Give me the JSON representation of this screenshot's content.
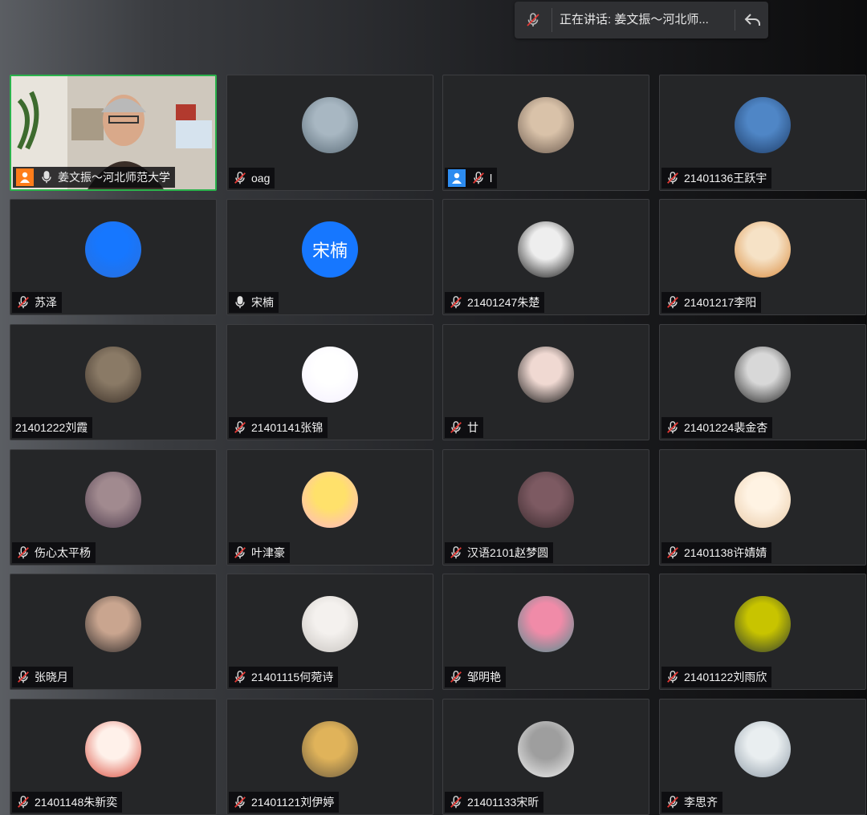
{
  "speaking_bar": {
    "text": "正在讲话: 姜文振～河北师...",
    "mic_state": "muted"
  },
  "colors": {
    "active_border": "#2bb24c",
    "host_badge": "#ff7d1a",
    "user_badge": "#2d8cf0",
    "text_avatar": "#1677ff"
  },
  "participants": [
    {
      "name": "姜文振～河北师范大学",
      "mic": "on",
      "badge": "host",
      "video": true,
      "active": true
    },
    {
      "name": "oag",
      "mic": "muted"
    },
    {
      "name": "l",
      "mic": "muted",
      "badge": "user"
    },
    {
      "name": "21401136王跃宇",
      "mic": "muted"
    },
    {
      "name": "苏泽",
      "mic": "muted"
    },
    {
      "name": "宋楠",
      "mic": "on",
      "avatar_text": "宋楠"
    },
    {
      "name": "21401247朱楚",
      "mic": "muted"
    },
    {
      "name": "21401217李阳",
      "mic": "muted"
    },
    {
      "name": "21401222刘霞",
      "mic": "none"
    },
    {
      "name": "21401141张锦",
      "mic": "muted"
    },
    {
      "name": "廿",
      "mic": "muted"
    },
    {
      "name": "21401224裴金杏",
      "mic": "muted"
    },
    {
      "name": "伤心太平杨",
      "mic": "muted"
    },
    {
      "name": "叶津豪",
      "mic": "muted"
    },
    {
      "name": "汉语2101赵梦圆",
      "mic": "muted"
    },
    {
      "name": "21401138许婧婧",
      "mic": "muted"
    },
    {
      "name": "张晓月",
      "mic": "muted"
    },
    {
      "name": "21401115何菀诗",
      "mic": "muted"
    },
    {
      "name": "邹明艳",
      "mic": "muted"
    },
    {
      "name": "21401122刘雨欣",
      "mic": "muted"
    },
    {
      "name": "21401148朱新奕",
      "mic": "muted"
    },
    {
      "name": "21401121刘伊婷",
      "mic": "muted"
    },
    {
      "name": "21401133宋昕",
      "mic": "muted"
    },
    {
      "name": "李思齐",
      "mic": "muted"
    }
  ]
}
